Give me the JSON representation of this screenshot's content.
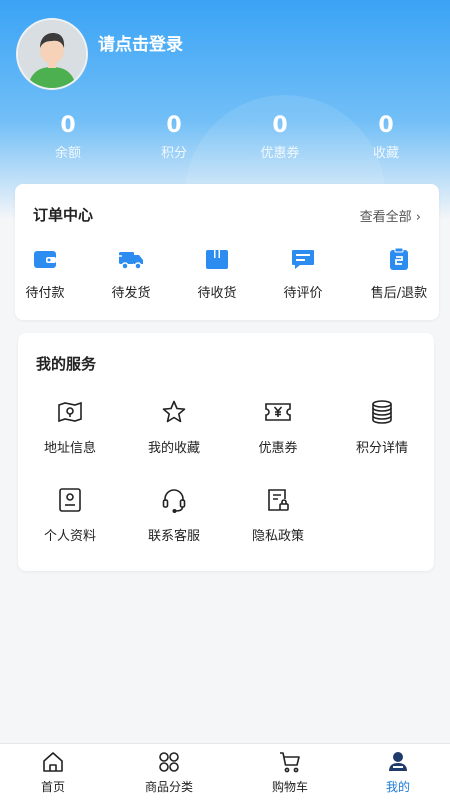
{
  "profile": {
    "login_prompt": "请点击登录"
  },
  "stats": [
    {
      "value": "0",
      "label": "余额"
    },
    {
      "value": "0",
      "label": "积分"
    },
    {
      "value": "0",
      "label": "优惠券"
    },
    {
      "value": "0",
      "label": "收藏"
    }
  ],
  "orders": {
    "title": "订单中心",
    "view_all": "查看全部 ›",
    "items": [
      {
        "label": "待付款",
        "icon": "wallet-icon"
      },
      {
        "label": "待发货",
        "icon": "truck-icon"
      },
      {
        "label": "待收货",
        "icon": "box-icon"
      },
      {
        "label": "待评价",
        "icon": "comment-icon"
      },
      {
        "label": "售后/退款",
        "icon": "refund-icon"
      }
    ]
  },
  "services": {
    "title": "我的服务",
    "items": [
      {
        "label": "地址信息",
        "icon": "map-pin-icon"
      },
      {
        "label": "我的收藏",
        "icon": "star-icon"
      },
      {
        "label": "优惠券",
        "icon": "coupon-icon"
      },
      {
        "label": "积分详情",
        "icon": "coins-icon"
      },
      {
        "label": "个人资料",
        "icon": "profile-card-icon"
      },
      {
        "label": "联系客服",
        "icon": "headset-icon"
      },
      {
        "label": "隐私政策",
        "icon": "privacy-doc-icon"
      }
    ]
  },
  "tabbar": {
    "items": [
      {
        "label": "首页",
        "icon": "home-icon"
      },
      {
        "label": "商品分类",
        "icon": "category-icon"
      },
      {
        "label": "购物车",
        "icon": "cart-icon"
      },
      {
        "label": "我的",
        "icon": "user-icon"
      }
    ],
    "active": "我的"
  },
  "colors": {
    "accent": "#1a7bd6",
    "icon_blue": "#2d8cf0",
    "header_top": "#3aa3f5"
  }
}
